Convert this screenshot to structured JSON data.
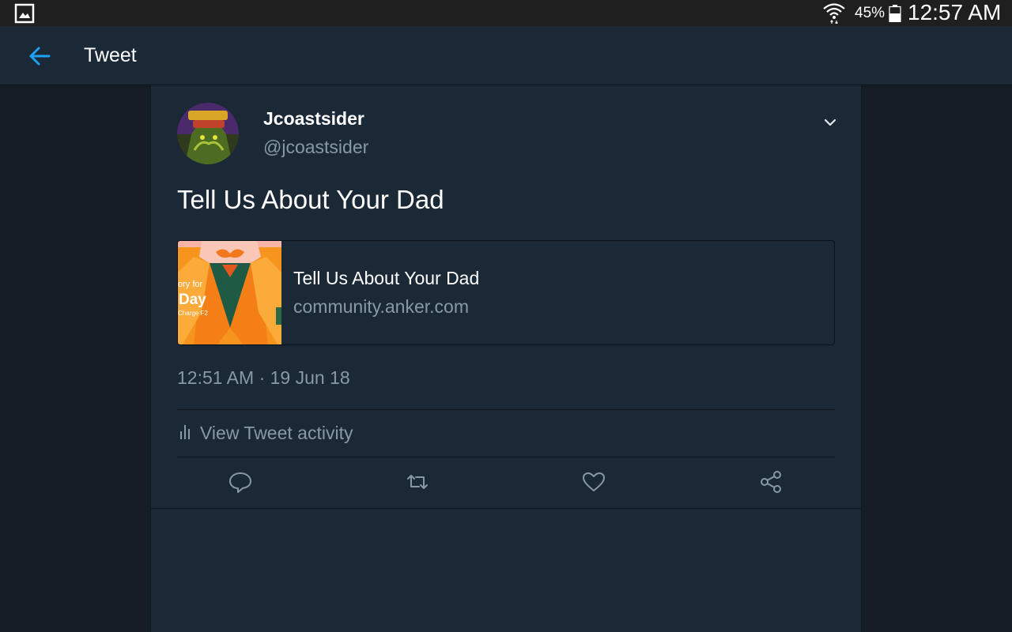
{
  "status_bar": {
    "battery_percent": "45%",
    "time": "12:57 AM",
    "icons": [
      "gallery-notification-icon",
      "wifi-icon",
      "battery-icon"
    ]
  },
  "header": {
    "title": "Tweet",
    "back_icon": "arrow-left-icon"
  },
  "tweet": {
    "display_name": "Jcoastsider",
    "handle": "@jcoastsider",
    "text": "Tell Us About Your Dad",
    "link_card": {
      "title": "Tell Us About Your Dad",
      "domain": "community.anker.com",
      "thumbnail_text": {
        "line1": "ory for",
        "line2": "Day",
        "line3": "Charge F2"
      }
    },
    "timestamp": "12:51 AM · 19 Jun 18",
    "activity_label": "View Tweet activity",
    "actions": [
      "reply-icon",
      "retweet-icon",
      "like-icon",
      "share-icon"
    ]
  },
  "colors": {
    "background": "#141d26",
    "surface": "#1b2836",
    "status_bar": "#1f1f1f",
    "accent": "#1da1f2",
    "secondary_text": "#8899a6",
    "thumbnail_orange": "#f7941d"
  }
}
